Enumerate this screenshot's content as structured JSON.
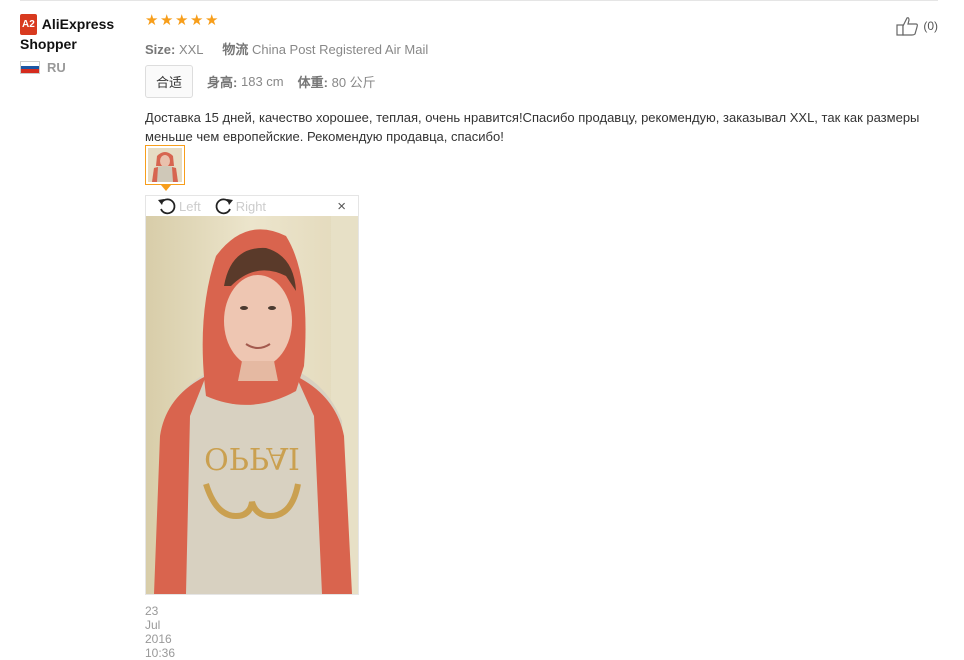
{
  "reviewer": {
    "badge": "A2",
    "name": "AliExpress Shopper",
    "country_code": "RU",
    "flag_colors": [
      "#ffffff",
      "#1c57a5",
      "#d52b1e"
    ]
  },
  "rating": {
    "stars": 5,
    "max": 5,
    "star_color": "#f79e1b"
  },
  "attributes": {
    "size_label": "Size:",
    "size_value": "XXL",
    "shipping_label": "物流",
    "shipping_value": "China Post Registered Air Mail",
    "fit_label": "合适",
    "height_label": "身高:",
    "height_value": "183 cm",
    "weight_label": "体重:",
    "weight_value": "80 公斤"
  },
  "review_text": "Доставка 15 дней, качество хорошее, теплая, очень нравится!Спасибо продавцу, рекомендую, заказывал XXL, так как размеры меньше чем европейские. Рекомендую продавца, спасибо!",
  "viewer": {
    "rotate_left": "Left",
    "rotate_right": "Right",
    "close": "×",
    "photo_print_text": "OPPAI"
  },
  "date": "23 Jul 2016 10:36",
  "helpful": {
    "count": "(0)"
  },
  "accent_color": "#f79e1b"
}
